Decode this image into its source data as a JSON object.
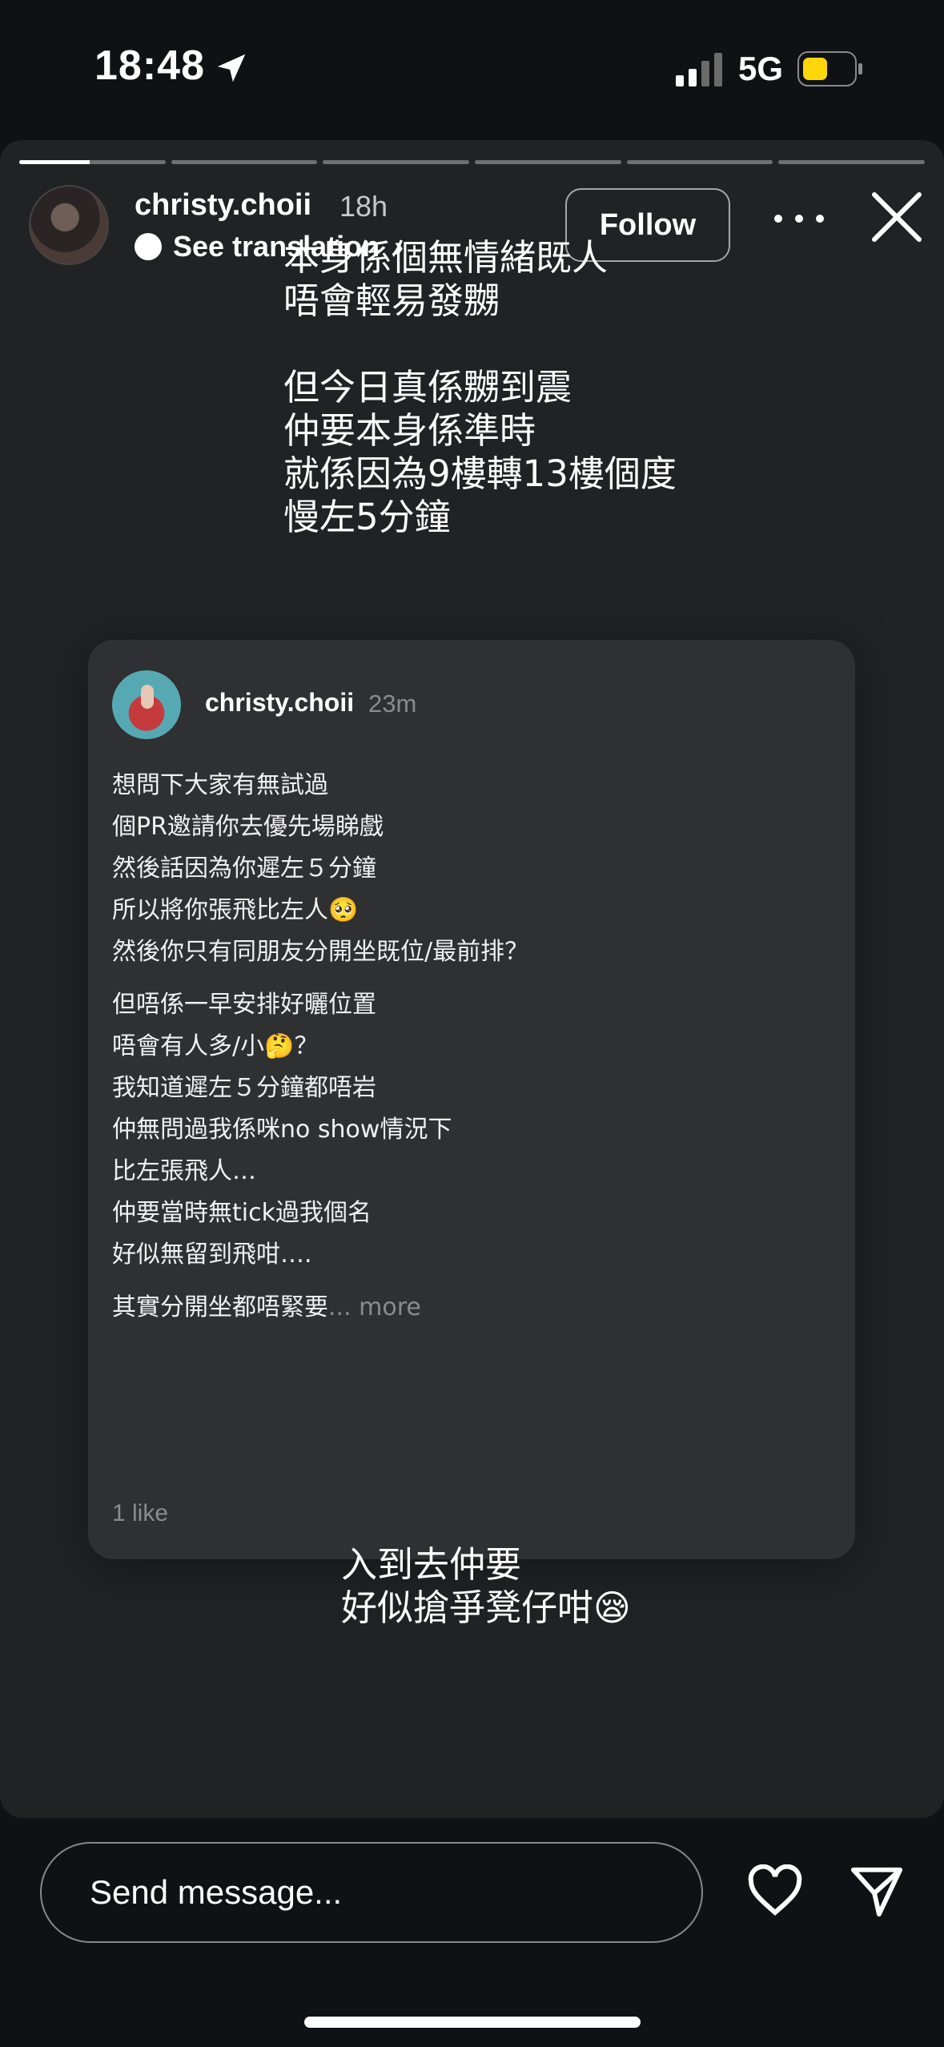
{
  "status": {
    "time": "18:48",
    "network": "5G"
  },
  "story": {
    "segments_total": 6,
    "segment_current_progress": [
      0.48,
      0,
      0,
      0,
      0,
      0
    ],
    "username": "christy.choii",
    "time_ago": "18h",
    "translate": "See translation",
    "follow": "Follow",
    "caption_top": [
      "本身係個無情緒既人",
      "唔會輕易發嬲",
      "",
      "但今日真係嬲到震",
      "仲要本身係準時",
      "就係因為9樓轉13樓個度",
      "慢左5分鐘"
    ],
    "caption_bottom": [
      "入到去仲要",
      "好似搶爭凳仔咁😪"
    ]
  },
  "card": {
    "username": "christy.choii",
    "time_ago": "23m",
    "paragraph1": [
      "想問下大家有無試過",
      "個PR邀請你去優先場睇戲",
      "然後話因為你遲左５分鐘",
      "所以將你張飛比左人🥺",
      "然後你只有同朋友分開坐既位/最前排？"
    ],
    "paragraph2": [
      "但唔係一早安排好曬位置",
      "唔會有人多/小🤔？",
      "我知道遲左５分鐘都唔岩",
      "仲無問過我係咪no show情況下",
      "比左張飛人…",
      "仲要當時無tick過我個名",
      "好似無留到飛咁…."
    ],
    "paragraph3_text": "其實分開坐都唔緊要",
    "paragraph3_more": "... more",
    "likes": "1 like"
  },
  "bottom": {
    "placeholder": "Send message..."
  },
  "icons": [
    "location-arrow-icon",
    "signal-icon",
    "battery-icon",
    "translate-icon",
    "more-icon",
    "close-icon",
    "heart-icon",
    "send-icon"
  ],
  "colors": {
    "background": "#0f1114",
    "story_bg": "#212223",
    "card_bg": "#2f3032",
    "battery_fill": "#ffd60a"
  }
}
